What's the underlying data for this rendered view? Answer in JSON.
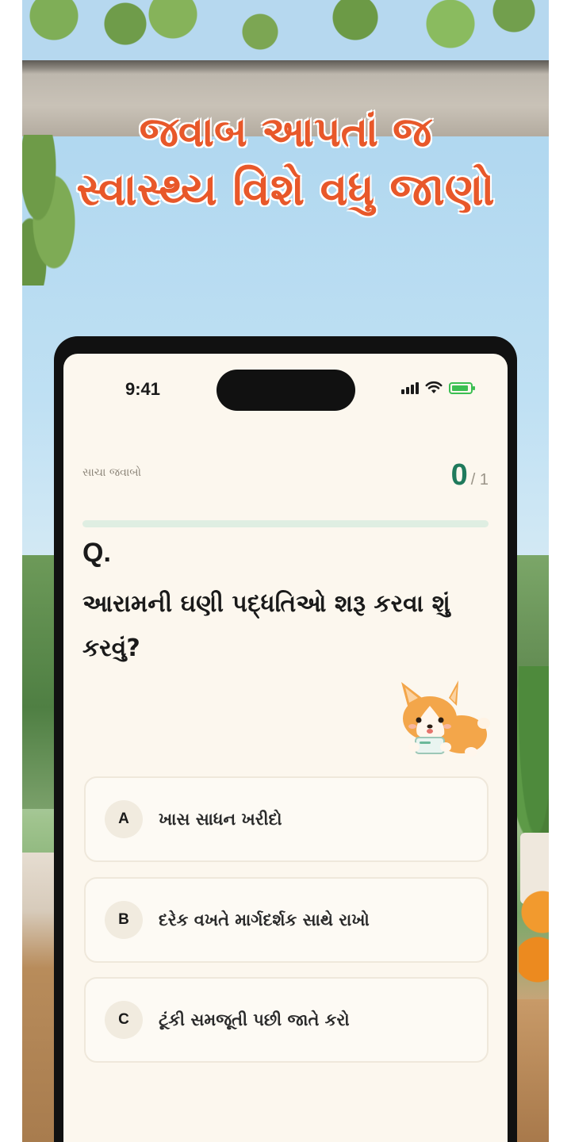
{
  "headline": {
    "line1": "જવાબ આપતાં જ",
    "line2": "સ્વાસ્થ્ય વિશે વધુ જાણો"
  },
  "status_bar": {
    "time": "9:41"
  },
  "quiz": {
    "score_label": "સાચા જવાબો",
    "score_value": "0",
    "score_total": "/ 1",
    "progress": 0,
    "question_marker": "Q.",
    "question_text": "આરામની ઘણી પદ્ધતિઓ શરૂ કરવા શું કરવું?",
    "options": [
      {
        "letter": "A",
        "text": "ખાસ સાધન ખરીદો"
      },
      {
        "letter": "B",
        "text": "દરેક વખતે માર્ગદર્શક સાથે રાખો"
      },
      {
        "letter": "C",
        "text": "ટૂંકી સમજૂતી પછી જાતે કરો"
      }
    ]
  },
  "colors": {
    "headline": "#e8582a",
    "accent_green": "#1f7a5c",
    "progress_track": "#dfeee2",
    "screen_bg": "#fcf7ee",
    "battery": "#3bbf52"
  },
  "icons": [
    "signal-icon",
    "wifi-icon",
    "battery-icon",
    "corgi-mascot"
  ]
}
